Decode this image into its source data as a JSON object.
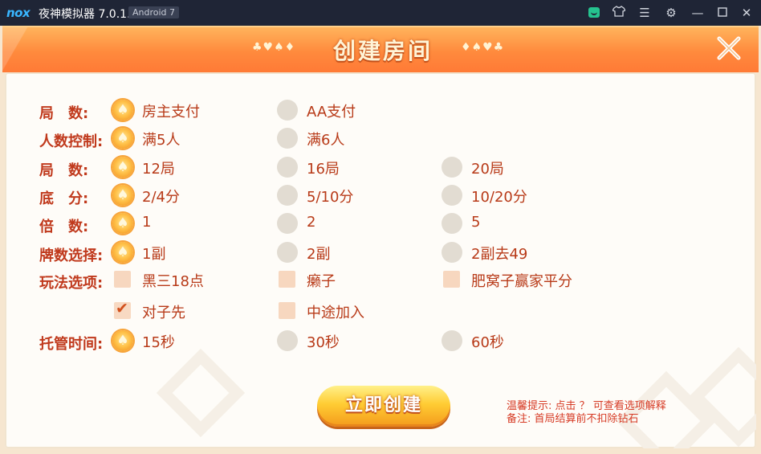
{
  "window": {
    "logo": "nox",
    "title": "夜神模拟器 7.0.1.0",
    "android_badge": "Android 7",
    "icons": [
      "store-icon",
      "shirt-icon",
      "menu-icon",
      "gear-icon",
      "minimize-icon",
      "maximize-icon",
      "close-icon"
    ]
  },
  "header": {
    "title": "创建房间",
    "left_suits": "♣♥♠♦",
    "right_suits": "♦♠♥♣",
    "close_icon": "close-icon"
  },
  "rows": [
    {
      "label": "局　数:",
      "type": "radio",
      "options": [
        {
          "label": "房主支付",
          "selected": true
        },
        {
          "label": "AA支付",
          "selected": false
        }
      ]
    },
    {
      "label": "人数控制:",
      "type": "radio",
      "options": [
        {
          "label": "满5人",
          "selected": true
        },
        {
          "label": "满6人",
          "selected": false
        }
      ]
    },
    {
      "label": "局　数:",
      "type": "radio",
      "options": [
        {
          "label": "12局",
          "selected": true
        },
        {
          "label": "16局",
          "selected": false
        },
        {
          "label": "20局",
          "selected": false
        }
      ]
    },
    {
      "label": "底　分:",
      "type": "radio",
      "options": [
        {
          "label": "2/4分",
          "selected": true
        },
        {
          "label": "5/10分",
          "selected": false
        },
        {
          "label": "10/20分",
          "selected": false
        }
      ]
    },
    {
      "label": "倍　数:",
      "type": "radio",
      "options": [
        {
          "label": "1",
          "selected": true
        },
        {
          "label": "2",
          "selected": false
        },
        {
          "label": "5",
          "selected": false
        }
      ]
    },
    {
      "label": "牌数选择:",
      "type": "radio",
      "options": [
        {
          "label": "1副",
          "selected": true
        },
        {
          "label": "2副",
          "selected": false
        },
        {
          "label": "2副去49",
          "selected": false
        }
      ]
    },
    {
      "label": "玩法选项:",
      "type": "checkbox",
      "options": [
        {
          "label": "黑三18点",
          "selected": false
        },
        {
          "label": "癞子",
          "selected": false
        },
        {
          "label": "肥窝子赢家平分",
          "selected": false
        }
      ]
    },
    {
      "label": "",
      "type": "checkbox",
      "options": [
        {
          "label": "对子先",
          "selected": true
        },
        {
          "label": "中途加入",
          "selected": false
        }
      ]
    },
    {
      "label": "托管时间:",
      "type": "radio",
      "options": [
        {
          "label": "15秒",
          "selected": true
        },
        {
          "label": "30秒",
          "selected": false
        },
        {
          "label": "60秒",
          "selected": false
        }
      ]
    }
  ],
  "create_button": "立即创建",
  "hints": {
    "line1": "温馨提示: 点击 ？ 可查看选项解释",
    "line2": "备注: 首局结算前不扣除钻石"
  },
  "colors": {
    "accent": "#ff8a3d",
    "label": "#c0391c",
    "option": "#b83a18",
    "hint": "#d63a24"
  }
}
